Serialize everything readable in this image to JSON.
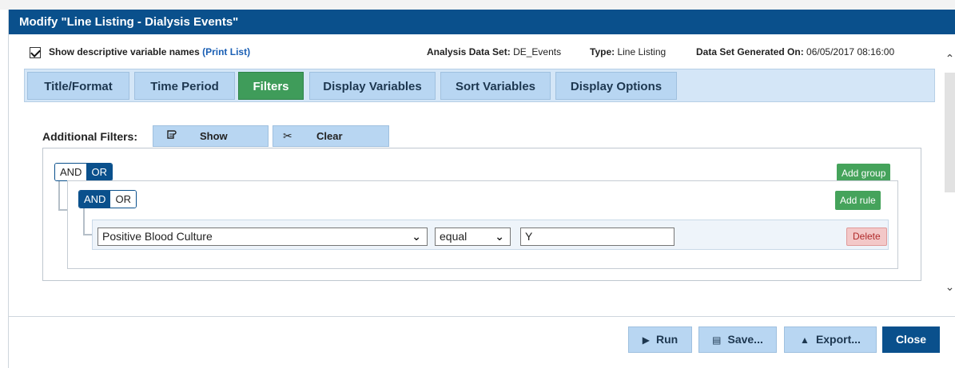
{
  "window": {
    "title": "Modify \"Line Listing - Dialysis Events\""
  },
  "info": {
    "show_names_label": "Show descriptive variable names",
    "print_list_link": "(Print List)",
    "dataset_label": "Analysis Data Set:",
    "dataset_value": "DE_Events",
    "type_label": "Type:",
    "type_value": "Line Listing",
    "generated_label": "Data Set Generated On:",
    "generated_value": "06/05/2017 08:16:00"
  },
  "tabs": [
    {
      "label": "Title/Format"
    },
    {
      "label": "Time Period"
    },
    {
      "label": "Filters",
      "active": true
    },
    {
      "label": "Display Variables"
    },
    {
      "label": "Sort Variables"
    },
    {
      "label": "Display Options"
    }
  ],
  "filters": {
    "label": "Additional Filters:",
    "show_label": "Show",
    "clear_label": "Clear",
    "outer_group": {
      "and_label": "AND",
      "or_label": "OR",
      "selected": "OR",
      "add_group_label": "Add group"
    },
    "inner_group": {
      "and_label": "AND",
      "or_label": "OR",
      "selected": "AND",
      "add_rule_label": "Add rule"
    },
    "rule": {
      "field": "Positive Blood Culture",
      "operator": "equal",
      "value": "Y",
      "delete_label": "Delete"
    }
  },
  "footer": {
    "run_label": "Run",
    "save_label": "Save...",
    "export_label": "Export...",
    "close_label": "Close"
  },
  "colors": {
    "titlebar": "#0a508c",
    "tab_bg": "#b8d6f2",
    "tab_active": "#3f9c5a",
    "green_button": "#45a35b",
    "delete_bg": "#f3c8c8"
  },
  "icons": {
    "show": "scroll-icon",
    "clear": "scissors-icon",
    "run": "play-icon",
    "save": "save-icon",
    "export": "export-icon"
  }
}
